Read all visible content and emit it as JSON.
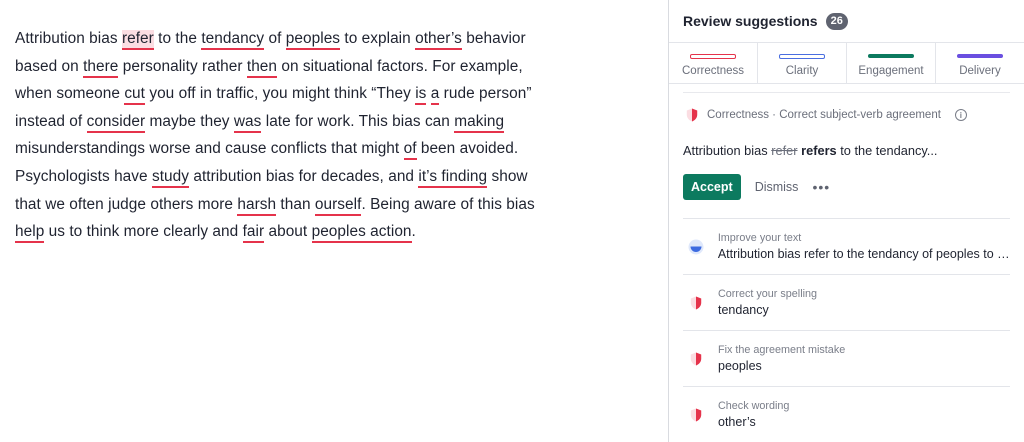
{
  "editor": {
    "segments": [
      {
        "t": "Attribution bias "
      },
      {
        "t": "refer",
        "u": true,
        "active": true
      },
      {
        "t": " to the "
      },
      {
        "t": "tendancy",
        "u": true
      },
      {
        "t": " of "
      },
      {
        "t": "peoples",
        "u": true
      },
      {
        "t": " to explain "
      },
      {
        "t": "other’s",
        "u": true
      },
      {
        "t": " behavior based on "
      },
      {
        "t": "there",
        "u": true
      },
      {
        "t": " personality rather "
      },
      {
        "t": "then",
        "u": true
      },
      {
        "t": " on situational factors. For example, when someone "
      },
      {
        "t": "cut",
        "u": true
      },
      {
        "t": " you off in traffic, you might think “They "
      },
      {
        "t": "is",
        "u": true
      },
      {
        "t": " "
      },
      {
        "t": "a",
        "u": true
      },
      {
        "t": " rude person” instead of "
      },
      {
        "t": "consider",
        "u": true
      },
      {
        "t": " maybe they "
      },
      {
        "t": "was",
        "u": true
      },
      {
        "t": " late for work. This bias can "
      },
      {
        "t": "making",
        "u": true
      },
      {
        "t": " misunderstandings worse and cause conflicts that might "
      },
      {
        "t": "of",
        "u": true
      },
      {
        "t": " been avoided. Psychologists have "
      },
      {
        "t": "study",
        "u": true
      },
      {
        "t": " attribution bias for decades, and "
      },
      {
        "t": "it’s finding",
        "u": true
      },
      {
        "t": " show that we often judge others more "
      },
      {
        "t": "harsh",
        "u": true
      },
      {
        "t": " than "
      },
      {
        "t": "ourself",
        "u": true
      },
      {
        "t": ". Being aware of this bias "
      },
      {
        "t": "help",
        "u": true
      },
      {
        "t": " us to think more clearly and "
      },
      {
        "t": "fair",
        "u": true
      },
      {
        "t": " about "
      },
      {
        "t": "peoples action",
        "u": true
      },
      {
        "t": "."
      }
    ]
  },
  "sidebar": {
    "title": "Review suggestions",
    "count": "26",
    "tabs": [
      {
        "label": "Correctness",
        "color": "#e5334b",
        "outlined": true
      },
      {
        "label": "Clarity",
        "color": "#4a6ee0",
        "outlined": true
      },
      {
        "label": "Engagement",
        "color": "#0c7a5f",
        "outlined": false
      },
      {
        "label": "Delivery",
        "color": "#6a4fe0",
        "outlined": false
      }
    ],
    "active_card": {
      "category": "Correctness · Correct subject-verb agreement",
      "preview_before": "Attribution bias ",
      "preview_strike": "refer",
      "preview_new": "refers",
      "preview_after": " to the tendancy...",
      "accept_label": "Accept",
      "dismiss_label": "Dismiss",
      "more_label": "•••"
    },
    "items": [
      {
        "label": "Improve your text",
        "value": "Attribution bias refer to the tendancy of peoples to explain other’s behavior",
        "icon": "improve-icon"
      },
      {
        "label": "Correct your spelling",
        "value": "tendancy",
        "icon": "correctness-shield-icon"
      },
      {
        "label": "Fix the agreement mistake",
        "value": "peoples",
        "icon": "correctness-shield-icon"
      },
      {
        "label": "Check wording",
        "value": "other’s",
        "icon": "correctness-shield-icon"
      }
    ],
    "colors": {
      "accent": "#0c7a5f",
      "error": "#e5334b"
    }
  }
}
